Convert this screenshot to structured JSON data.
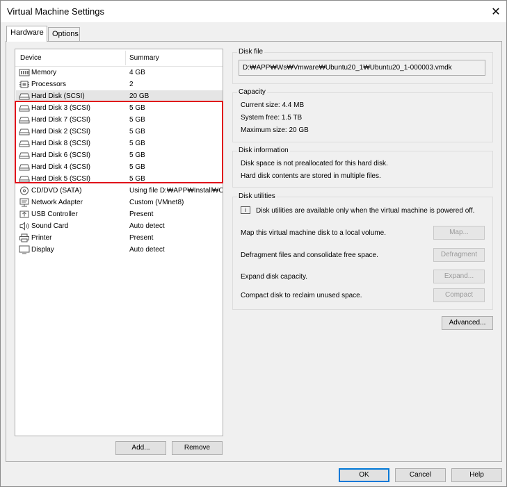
{
  "window": {
    "title": "Virtual Machine Settings",
    "close_glyph": "✕"
  },
  "tabs": [
    {
      "label": "Hardware",
      "active": true
    },
    {
      "label": "Options",
      "active": false
    }
  ],
  "device_list": {
    "header_device": "Device",
    "header_summary": "Summary",
    "rows": [
      {
        "name": "Memory",
        "summary": "4 GB",
        "icon": "memory-icon"
      },
      {
        "name": "Processors",
        "summary": "2",
        "icon": "processor-icon"
      },
      {
        "name": "Hard Disk (SCSI)",
        "summary": "20 GB",
        "icon": "hard-disk-icon"
      },
      {
        "name": "Hard Disk 3 (SCSI)",
        "summary": "5 GB",
        "icon": "hard-disk-icon"
      },
      {
        "name": "Hard Disk 7 (SCSI)",
        "summary": "5 GB",
        "icon": "hard-disk-icon"
      },
      {
        "name": "Hard Disk 2 (SCSI)",
        "summary": "5 GB",
        "icon": "hard-disk-icon"
      },
      {
        "name": "Hard Disk 8 (SCSI)",
        "summary": "5 GB",
        "icon": "hard-disk-icon"
      },
      {
        "name": "Hard Disk 6 (SCSI)",
        "summary": "5 GB",
        "icon": "hard-disk-icon"
      },
      {
        "name": "Hard Disk 4 (SCSI)",
        "summary": "5 GB",
        "icon": "hard-disk-icon"
      },
      {
        "name": "Hard Disk 5 (SCSI)",
        "summary": "5 GB",
        "icon": "hard-disk-icon"
      },
      {
        "name": "CD/DVD (SATA)",
        "summary": "Using file D:₩APP₩Install₩O...",
        "icon": "cd-dvd-icon"
      },
      {
        "name": "Network Adapter",
        "summary": "Custom (VMnet8)",
        "icon": "network-adapter-icon"
      },
      {
        "name": "USB Controller",
        "summary": "Present",
        "icon": "usb-icon"
      },
      {
        "name": "Sound Card",
        "summary": "Auto detect",
        "icon": "speaker-icon"
      },
      {
        "name": "Printer",
        "summary": "Present",
        "icon": "printer-icon"
      },
      {
        "name": "Display",
        "summary": "Auto detect",
        "icon": "display-icon"
      }
    ],
    "add_label": "Add...",
    "remove_label": "Remove"
  },
  "disk_file": {
    "label": "Disk file",
    "path": "D:₩APP₩Ws₩Vmware₩Ubuntu20_1₩Ubuntu20_1-000003.vmdk"
  },
  "capacity": {
    "label": "Capacity",
    "current": "Current size:  4.4 MB",
    "free": "System free:  1.5 TB",
    "maximum": "Maximum size:  20 GB"
  },
  "disk_information": {
    "label": "Disk information",
    "line1": "Disk space is not preallocated for this hard disk.",
    "line2": "Hard disk contents are stored in multiple files."
  },
  "disk_utilities": {
    "label": "Disk utilities",
    "notice": "Disk utilities are available only when the virtual machine is powered off.",
    "map_text": "Map this virtual machine disk to a local volume.",
    "map_btn": "Map...",
    "defrag_text": "Defragment files and consolidate free space.",
    "defrag_btn": "Defragment",
    "expand_text": "Expand disk capacity.",
    "expand_btn": "Expand...",
    "compact_text": "Compact disk to reclaim unused space.",
    "compact_btn": "Compact"
  },
  "advanced_btn": "Advanced...",
  "footer": {
    "ok": "OK",
    "cancel": "Cancel",
    "help": "Help"
  },
  "colors": {
    "highlight": "#e0101a",
    "default_button_border": "#0078d7"
  }
}
